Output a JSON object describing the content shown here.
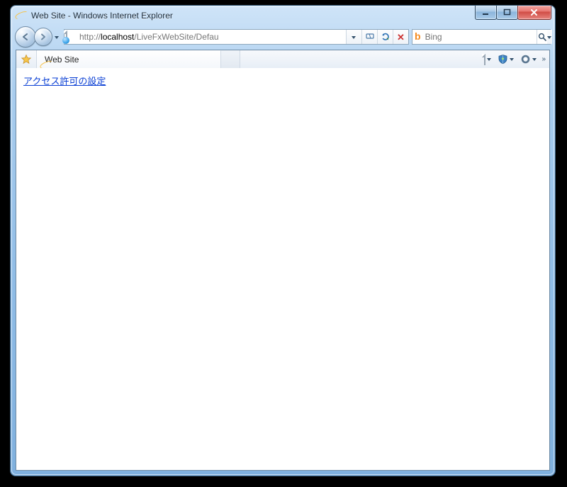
{
  "window": {
    "title": "Web Site - Windows Internet Explorer",
    "controls": {
      "minimize": "minimize",
      "maximize": "maximize",
      "close": "close"
    }
  },
  "nav": {
    "back_icon": "back-arrow",
    "forward_icon": "forward-arrow",
    "dropdown_icon": "chevron-down"
  },
  "address": {
    "scheme_prefix": "http://",
    "host": "localhost",
    "path_suffix": "/LiveFxWebSite/Defau",
    "dropdown_icon": "chevron-down",
    "compat_icon": "compatibility-view",
    "refresh_icon": "refresh",
    "stop_icon": "stop"
  },
  "search": {
    "provider_icon": "bing",
    "placeholder": "Bing",
    "go_icon": "search",
    "dropdown_icon": "chevron-down"
  },
  "tabs": {
    "favorites_icon": "star",
    "items": [
      {
        "icon": "ie",
        "title": "Web Site"
      }
    ],
    "new_tab_icon": "new-tab"
  },
  "command_bar": {
    "items": [
      {
        "name": "page-menu",
        "icon": "page"
      },
      {
        "name": "safety-menu",
        "icon": "shield"
      },
      {
        "name": "tools-menu",
        "icon": "gear"
      }
    ],
    "overflow_icon": "chevrons-right"
  },
  "page": {
    "link_text": "アクセス許可の設定"
  }
}
